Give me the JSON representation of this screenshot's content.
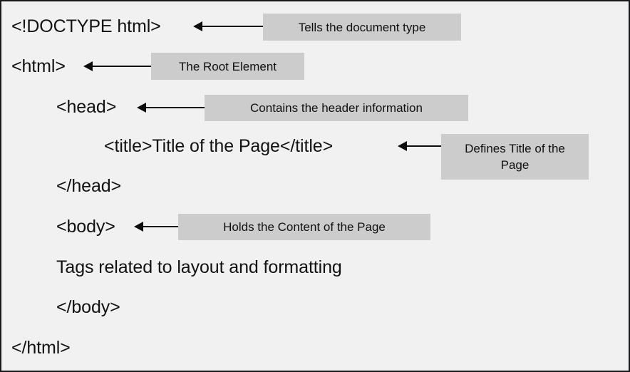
{
  "diagram": {
    "title": "HTML document structure diagram",
    "background_color": "#f1f1f1",
    "border_color": "#17191a",
    "callout_fill_color": "#cccccc",
    "text_color": "#121212",
    "arrow_color": "#0d0d0d",
    "code_lines": [
      {
        "text": "<!DOCTYPE html>",
        "indent": 0
      },
      {
        "text": "<html>",
        "indent": 0
      },
      {
        "text": "<head>",
        "indent": 1
      },
      {
        "text": "<title>Title of the Page</title>",
        "indent": 2
      },
      {
        "text": "</head>",
        "indent": 1
      },
      {
        "text": "<body>",
        "indent": 1
      },
      {
        "text": "Tags related to layout and formatting",
        "indent": 1
      },
      {
        "text": "</body>",
        "indent": 1
      },
      {
        "text": "</html>",
        "indent": 0
      }
    ],
    "callouts": [
      {
        "text": "Tells the document type",
        "target": "<!DOCTYPE html>"
      },
      {
        "text": "The Root Element",
        "target": "<html>"
      },
      {
        "text": "Contains the header information",
        "target": "<head>"
      },
      {
        "text": "Defines Title of the Page",
        "target": "<title>"
      },
      {
        "text": "Holds the Content of the Page",
        "target": "<body>"
      }
    ]
  }
}
